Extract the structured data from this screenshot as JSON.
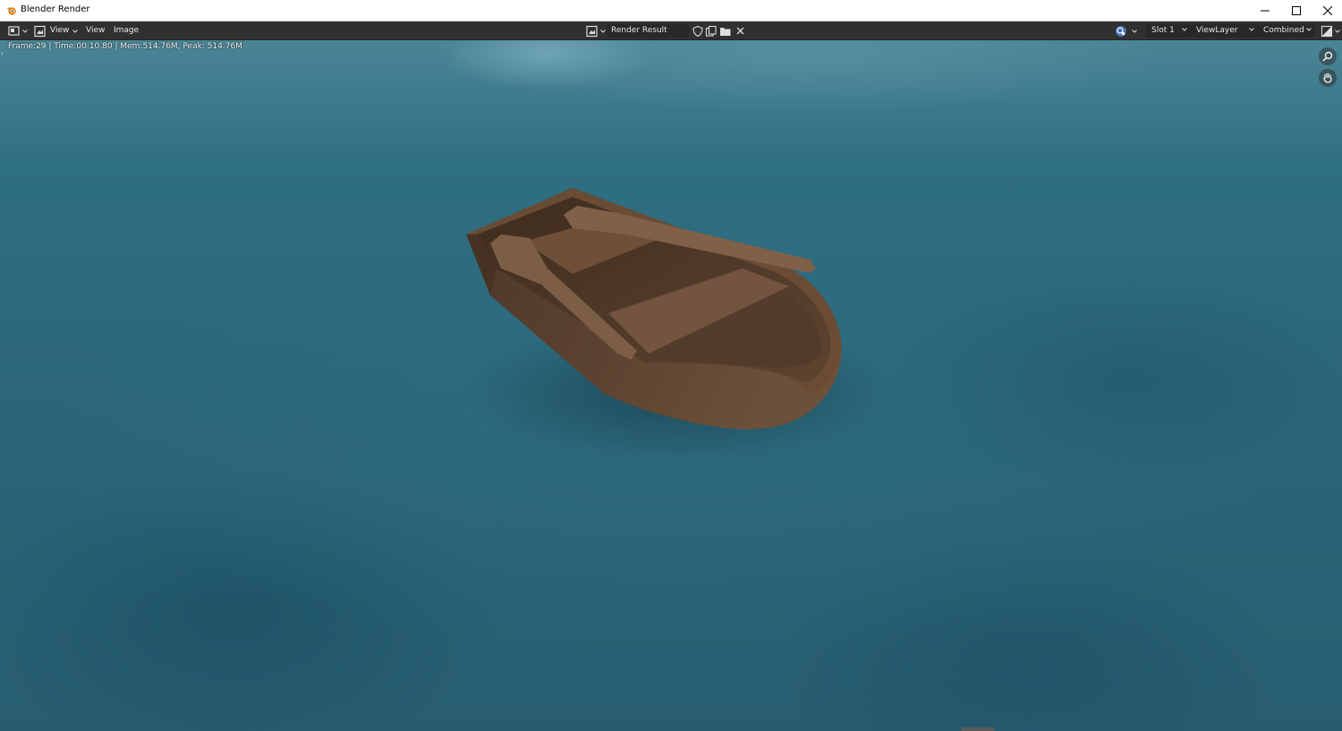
{
  "window": {
    "title": "Blender Render",
    "app_icon": "blender-logo-icon",
    "controls": [
      "minimize-icon",
      "maximize-icon",
      "close-icon"
    ]
  },
  "header": {
    "editor_type_icon": "image-editor-icon",
    "mode_icon": "view-mode-icon",
    "menus": {
      "view_mode": "View",
      "view": "View",
      "image": "Image"
    },
    "image_browse_icon": "image-browse-icon",
    "image_name": "Render Result",
    "image_actions": [
      "fake-user-shield-icon",
      "new-image-icon",
      "open-folder-icon",
      "unlink-x-icon"
    ],
    "overlay_icon": "gizmo-overlay-icon",
    "slot": "Slot 1",
    "view_layer": "ViewLayer",
    "pass": "Combined",
    "display_channels_icon": "display-channels-icon"
  },
  "viewport": {
    "render_info": "Frame:29 | Time:00:10.80 | Mem:514.76M, Peak: 514.76M",
    "nav_icons": [
      "zoom-magnifier-icon",
      "pan-hand-icon"
    ]
  },
  "colors": {
    "header_bg": "#303030",
    "water": "#2b6679",
    "wood": "#6b4d36"
  }
}
